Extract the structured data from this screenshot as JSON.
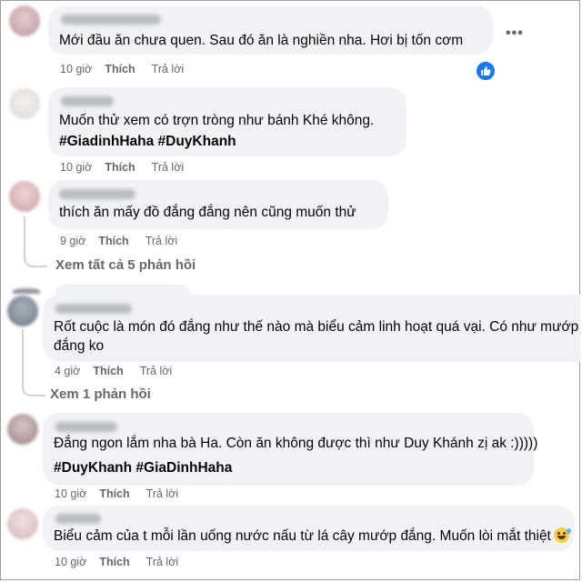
{
  "comments": [
    {
      "text_lines": [
        "Mới đầu ăn chưa quen. Sau đó ăn là nghiền nha. Hơi bị tốn cơm"
      ],
      "hashtags": "",
      "time": "10 giờ",
      "like_label": "Thích",
      "reply_label": "Trả lời",
      "avatar_color": "#c7a8ae"
    },
    {
      "text_lines": [
        "Muốn thử xem có trợn tròng như bánh Khé không."
      ],
      "hashtags": "#GiadinhHaha #DuyKhanh",
      "time": "10 giờ",
      "like_label": "Thích",
      "reply_label": "Trả lời",
      "avatar_color": "#e9e6e4"
    },
    {
      "text_lines": [
        "thích ăn mấy đồ đắng đắng nên cũng muốn thử"
      ],
      "hashtags": "",
      "time": "9 giờ",
      "like_label": "Thích",
      "reply_label": "Trả lời",
      "avatar_color": "#d9b5b8"
    },
    {
      "text_lines": [
        "Rốt cuộc là món đó đắng như thế nào mà biểu cảm linh hoạt quá vại. Có như mướp",
        "đắng ko"
      ],
      "hashtags": "",
      "time": "4 giờ",
      "like_label": "Thích",
      "reply_label": "Trả lời",
      "avatar_color": "#8d96a3"
    },
    {
      "text_lines": [
        "Đắng ngon lắm nha bà Ha. Còn ăn không được thì như Duy Khánh zị ak :)))))"
      ],
      "hashtags": "#DuyKhanh #GiaDinhHaha",
      "time": "10 giờ",
      "like_label": "Thích",
      "reply_label": "Trả lời",
      "avatar_color": "#b8a4a6"
    },
    {
      "text_lines": [
        "Biểu cảm của t mỗi lần uống nước nấu từ lá cây mướp đắng. Muốn lòi mắt thiệt"
      ],
      "hashtags": "",
      "time": "10 giờ",
      "like_label": "Thích",
      "reply_label": "Trả lời",
      "avatar_color": "#e3cfd1"
    }
  ],
  "view_replies": {
    "c3": "Xem tất cả 5 phản hồi",
    "c4": "Xem 1 phản hồi"
  },
  "more_options": "•••",
  "like_reaction_icon": "thumbs-up-icon",
  "emoji_icon": "sweat-smile-emoji-icon",
  "colors": {
    "bubble": "#f0f2f5",
    "meta_text": "#65676b",
    "reaction_blue": "#1877f2"
  }
}
